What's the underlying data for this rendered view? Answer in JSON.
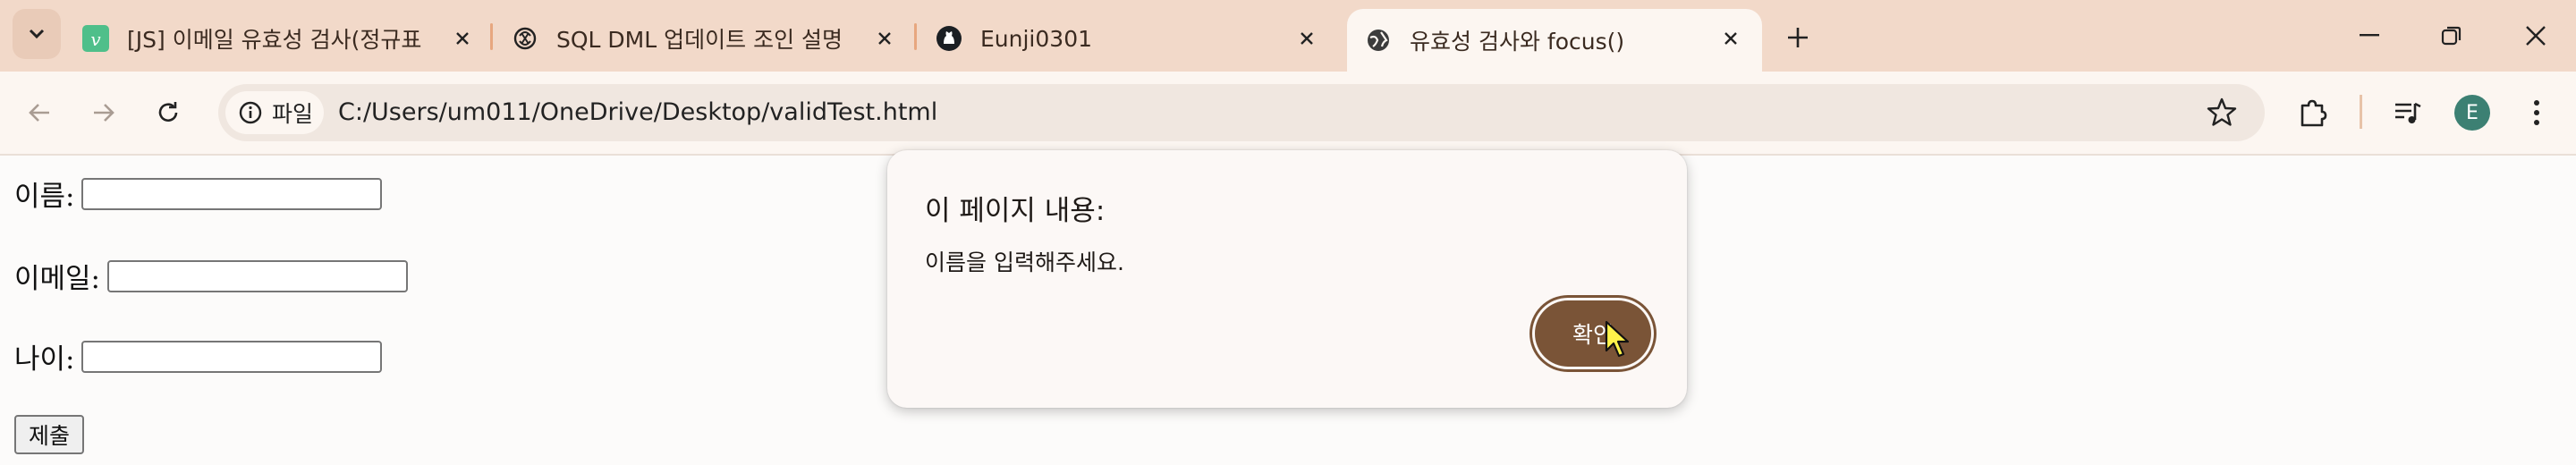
{
  "tabs": [
    {
      "title": "[JS] 이메일 유효성 검사(정규표",
      "favicon": "vuepress-v-icon"
    },
    {
      "title": "SQL DML 업데이트 조인 설명",
      "favicon": "chatgpt-icon"
    },
    {
      "title": "Eunji0301",
      "favicon": "github-icon"
    },
    {
      "title": "유효성 검사와 focus()",
      "favicon": "globe-icon",
      "active": true
    }
  ],
  "toolbar": {
    "chip_label": "파일",
    "url": "C:/Users/um011/OneDrive/Desktop/validTest.html",
    "avatar_letter": "E"
  },
  "form": {
    "name_label": "이름:",
    "email_label": "이메일:",
    "age_label": "나이:",
    "name_value": "",
    "email_value": "",
    "age_value": "",
    "submit_label": "제출"
  },
  "dialog": {
    "title": "이 페이지 내용:",
    "message": "이름을 입력해주세요.",
    "ok_label": "확인"
  },
  "colors": {
    "tabstrip": "#f2d9c9",
    "toolbar": "#fcf6f1",
    "accent_button": "#7a5437",
    "avatar": "#3c8073"
  }
}
